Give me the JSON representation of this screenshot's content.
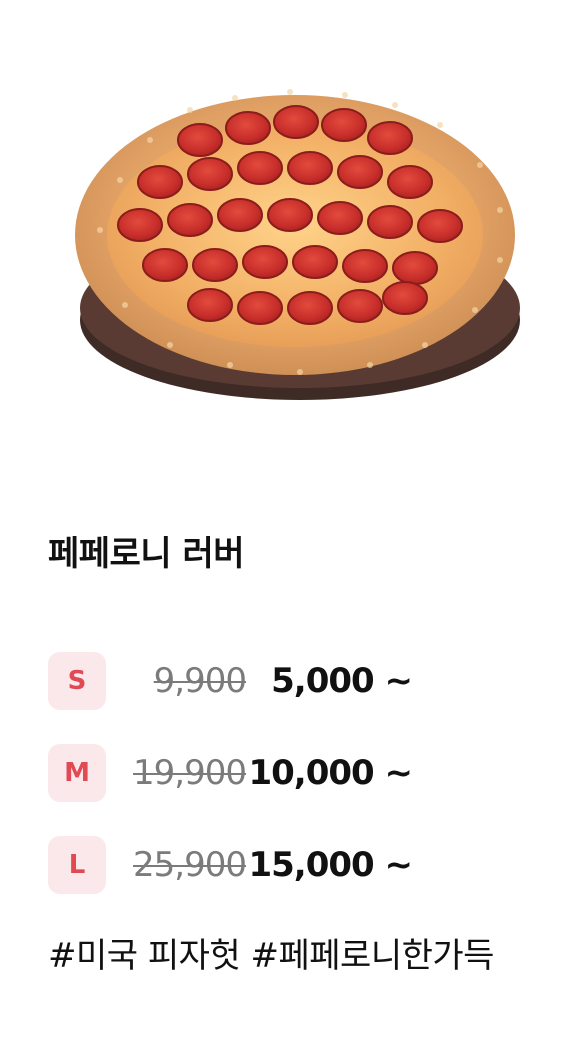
{
  "product": {
    "name": "페페로니 러버",
    "hashtags": "#미국 피자헛 #페페로니한가득"
  },
  "prices": [
    {
      "size": "S",
      "original": "9,900",
      "sale": "5,000 ~"
    },
    {
      "size": "M",
      "original": "19,900",
      "sale": "10,000 ~"
    },
    {
      "size": "L",
      "original": "25,900",
      "sale": "15,000 ~"
    }
  ],
  "colors": {
    "badge_bg": "#fbe8ea",
    "badge_text": "#e14a54",
    "strike_text": "#7b7b7b"
  },
  "icons": {
    "hero_image": "pepperoni-pizza-image"
  }
}
